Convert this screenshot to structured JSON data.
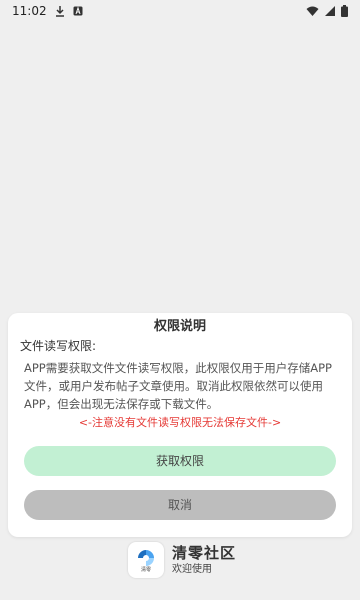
{
  "status_bar": {
    "time": "11:02",
    "icons": [
      "download-icon",
      "a-icon",
      "wifi-icon",
      "signal-icon",
      "battery-icon"
    ]
  },
  "dialog": {
    "title": "权限说明",
    "permission_heading": "文件读写权限:",
    "description_line1": "APP需要获取文件文件读写权限，此权限仅用于用户存储APP",
    "description_line2": "文件，或用户发布帖子文章使用。取消此权限依然可以使用",
    "description_line3": "APP，但会出现无法保存或下载文件。",
    "warning": "<-注意没有文件读写权限无法保存文件->",
    "grant_button": "获取权限",
    "cancel_button": "取消"
  },
  "brand": {
    "logo_text": "清零",
    "name": "清零社区",
    "slogan": "欢迎使用"
  },
  "colors": {
    "background": "#efefef",
    "warning": "#e53935",
    "grant_button": "#c2f0d3",
    "cancel_button": "#bdbdbd",
    "logo_accent": "#4aa3f0"
  }
}
